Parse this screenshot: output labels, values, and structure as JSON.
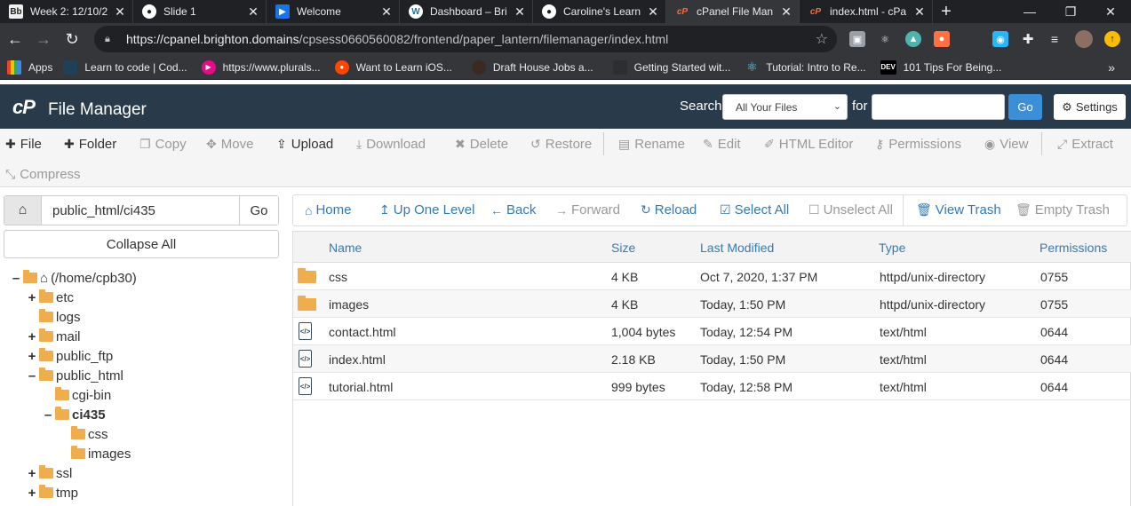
{
  "browser": {
    "tabs": [
      {
        "title": "Week 2: 12/10/2",
        "icon": "blackboard-icon",
        "active": false
      },
      {
        "title": "Slide 1",
        "icon": "globe-icon",
        "active": false
      },
      {
        "title": "Welcome",
        "icon": "video-icon",
        "active": false
      },
      {
        "title": "Dashboard – Bri",
        "icon": "wordpress-icon",
        "active": false
      },
      {
        "title": "Caroline's Learn",
        "icon": "globe-icon",
        "active": false
      },
      {
        "title": "cPanel File Man",
        "icon": "cpanel-icon",
        "active": true
      },
      {
        "title": "index.html - cPa",
        "icon": "cpanel-icon",
        "active": false
      }
    ],
    "new_tab": "+",
    "url_host": "https://cpanel.brighton.domains",
    "url_path": "/cpsess0660560082/frontend/paper_lantern/filemanager/index.html",
    "bookmarks": [
      {
        "label": "Apps",
        "icon": "apps-grid-icon"
      },
      {
        "label": "Learn to code | Cod...",
        "icon": "codecademy-icon"
      },
      {
        "label": "https://www.plurals...",
        "icon": "pluralsight-icon"
      },
      {
        "label": "Want to Learn iOS...",
        "icon": "reddit-icon"
      },
      {
        "label": "Draft House Jobs a...",
        "icon": "drafthouse-icon"
      },
      {
        "label": "Getting Started wit...",
        "icon": "page-icon"
      },
      {
        "label": "Tutorial: Intro to Re...",
        "icon": "react-icon"
      },
      {
        "label": "101 Tips For Being...",
        "icon": "dev-icon"
      }
    ],
    "bookmarks_more": "»"
  },
  "cpanel": {
    "logo": "cP",
    "title": "File Manager",
    "search_label": "Search",
    "search_scope": "All Your Files",
    "for_label": "for",
    "search_value": "",
    "go_label": "Go",
    "settings_label": "Settings"
  },
  "actions": [
    {
      "label": "File",
      "icon": "plus-icon",
      "enabled": true
    },
    {
      "label": "Folder",
      "icon": "plus-icon",
      "enabled": true
    },
    {
      "label": "Copy",
      "icon": "copy-icon",
      "enabled": false
    },
    {
      "label": "Move",
      "icon": "move-icon",
      "enabled": false
    },
    {
      "label": "Upload",
      "icon": "upload-icon",
      "enabled": true
    },
    {
      "label": "Download",
      "icon": "download-icon",
      "enabled": false
    },
    {
      "label": "Delete",
      "icon": "delete-icon",
      "enabled": false
    },
    {
      "label": "Restore",
      "icon": "restore-icon",
      "enabled": false
    },
    {
      "label": "Rename",
      "icon": "rename-icon",
      "enabled": false
    },
    {
      "label": "Edit",
      "icon": "pencil-icon",
      "enabled": false
    },
    {
      "label": "HTML Editor",
      "icon": "html-editor-icon",
      "enabled": false
    },
    {
      "label": "Permissions",
      "icon": "key-icon",
      "enabled": false
    },
    {
      "label": "View",
      "icon": "eye-icon",
      "enabled": false
    },
    {
      "label": "Extract",
      "icon": "expand-icon",
      "enabled": false
    },
    {
      "label": "Compress",
      "icon": "compress-icon",
      "enabled": false
    }
  ],
  "sidebar": {
    "path_value": "public_html/ci435",
    "go_label": "Go",
    "collapse_label": "Collapse All",
    "tree": [
      {
        "label": "(/home/cpb30)",
        "toggle": "–",
        "home": true
      },
      {
        "label": "etc",
        "toggle": "+"
      },
      {
        "label": "logs",
        "toggle": ""
      },
      {
        "label": "mail",
        "toggle": "+"
      },
      {
        "label": "public_ftp",
        "toggle": "+"
      },
      {
        "label": "public_html",
        "toggle": "–"
      },
      {
        "label": "cgi-bin",
        "toggle": ""
      },
      {
        "label": "ci435",
        "toggle": "–",
        "bold": true
      },
      {
        "label": "css",
        "toggle": ""
      },
      {
        "label": "images",
        "toggle": ""
      },
      {
        "label": "ssl",
        "toggle": "+"
      },
      {
        "label": "tmp",
        "toggle": "+"
      }
    ]
  },
  "nav": [
    {
      "label": "Home",
      "icon": "home-icon",
      "enabled": true
    },
    {
      "label": "Up One Level",
      "icon": "up-arrow-icon",
      "enabled": true
    },
    {
      "label": "Back",
      "icon": "back-arrow-icon",
      "enabled": true
    },
    {
      "label": "Forward",
      "icon": "forward-arrow-icon",
      "enabled": false
    },
    {
      "label": "Reload",
      "icon": "reload-icon",
      "enabled": true
    },
    {
      "label": "Select All",
      "icon": "checked-box-icon",
      "enabled": true
    },
    {
      "label": "Unselect All",
      "icon": "empty-box-icon",
      "enabled": false
    },
    {
      "label": "View Trash",
      "icon": "trash-icon",
      "enabled": true
    },
    {
      "label": "Empty Trash",
      "icon": "trash-icon",
      "enabled": false
    }
  ],
  "files": {
    "columns": [
      "Name",
      "Size",
      "Last Modified",
      "Type",
      "Permissions"
    ],
    "rows": [
      {
        "name": "css",
        "size": "4 KB",
        "modified": "Oct 7, 2020, 1:37 PM",
        "type": "httpd/unix-directory",
        "perms": "0755",
        "kind": "folder"
      },
      {
        "name": "images",
        "size": "4 KB",
        "modified": "Today, 1:50 PM",
        "type": "httpd/unix-directory",
        "perms": "0755",
        "kind": "folder"
      },
      {
        "name": "contact.html",
        "size": "1,004 bytes",
        "modified": "Today, 12:54 PM",
        "type": "text/html",
        "perms": "0644",
        "kind": "html"
      },
      {
        "name": "index.html",
        "size": "2.18 KB",
        "modified": "Today, 1:50 PM",
        "type": "text/html",
        "perms": "0644",
        "kind": "html"
      },
      {
        "name": "tutorial.html",
        "size": "999 bytes",
        "modified": "Today, 12:58 PM",
        "type": "text/html",
        "perms": "0644",
        "kind": "html"
      }
    ]
  },
  "colors": {
    "header_bg": "#293a4a",
    "link_blue": "#337ab7",
    "folder_orange": "#f0ad4e",
    "go_button": "#3a8fd6"
  }
}
